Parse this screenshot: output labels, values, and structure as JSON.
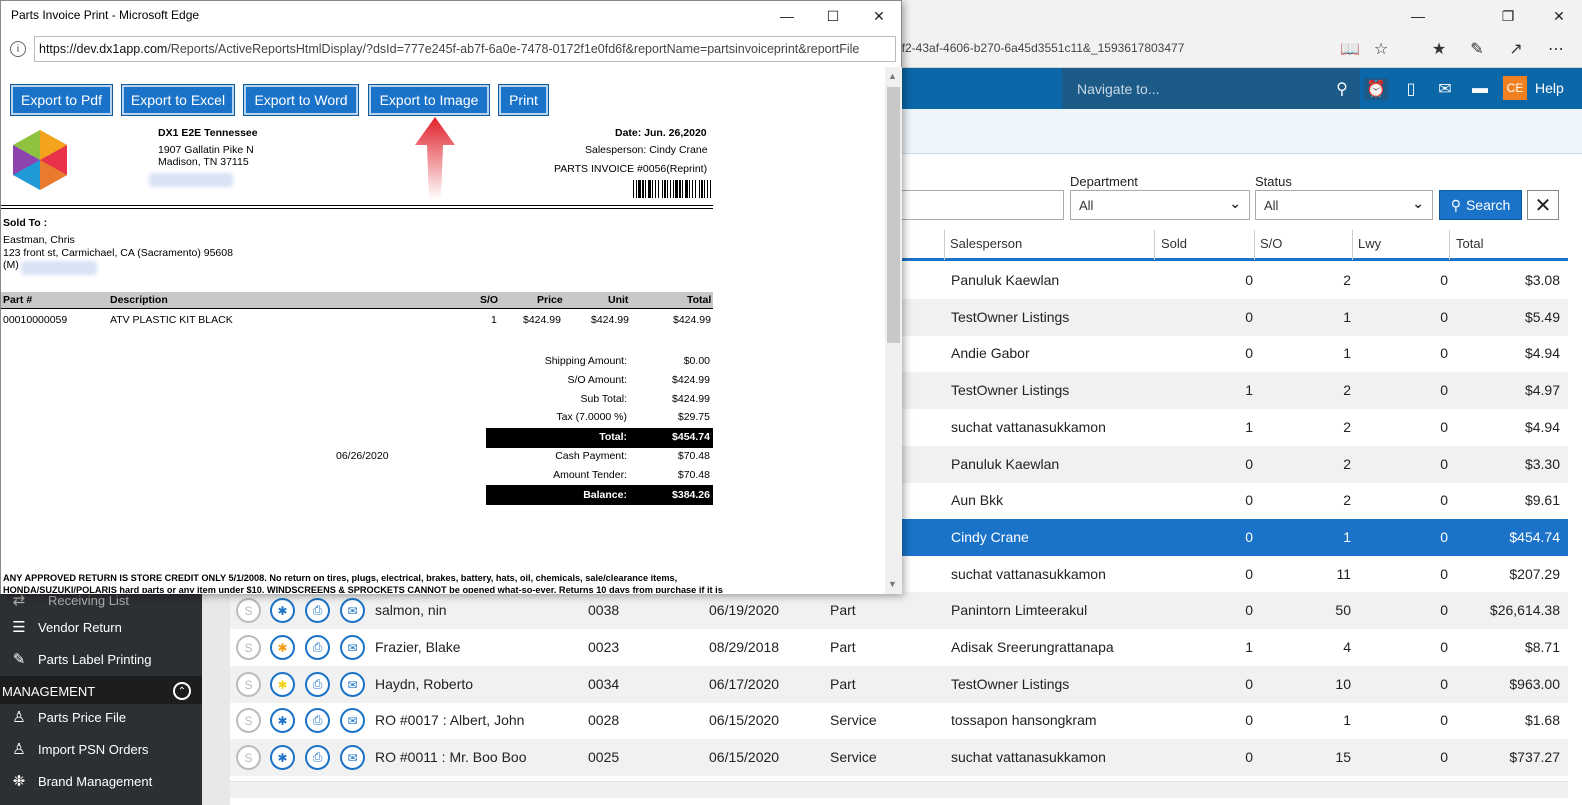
{
  "back_window": {
    "url_tail": "bf2-43af-4606-b270-6a45d3551c11&_1593617803477",
    "nav": {
      "search_placeholder": "Navigate to...",
      "avatar": "CE",
      "help": "Help"
    },
    "filters": {
      "department_label": "Department",
      "department_value": "All",
      "status_label": "Status",
      "status_value": "All",
      "search_button": "Search"
    },
    "table": {
      "headers": [
        "Salesperson",
        "Sold",
        "S/O",
        "Lwy",
        "Total"
      ],
      "rows": [
        {
          "salesperson": "Panuluk Kaewlan",
          "sold": "0",
          "so": "2",
          "lwy": "0",
          "total": "$3.08"
        },
        {
          "salesperson": "TestOwner Listings",
          "sold": "0",
          "so": "1",
          "lwy": "0",
          "total": "$5.49"
        },
        {
          "salesperson": "Andie Gabor",
          "sold": "0",
          "so": "1",
          "lwy": "0",
          "total": "$4.94"
        },
        {
          "salesperson": "TestOwner Listings",
          "sold": "1",
          "so": "2",
          "lwy": "0",
          "total": "$4.97"
        },
        {
          "salesperson": "suchat vattanasukkamon",
          "sold": "1",
          "so": "2",
          "lwy": "0",
          "total": "$4.94"
        },
        {
          "salesperson": "Panuluk Kaewlan",
          "sold": "0",
          "so": "2",
          "lwy": "0",
          "total": "$3.30"
        },
        {
          "salesperson": "Aun Bkk",
          "sold": "0",
          "so": "2",
          "lwy": "0",
          "total": "$9.61"
        },
        {
          "salesperson": "Cindy Crane",
          "sold": "0",
          "so": "1",
          "lwy": "0",
          "total": "$454.74"
        },
        {
          "salesperson": "suchat vattanasukkamon",
          "sold": "0",
          "so": "11",
          "lwy": "0",
          "total": "$207.29"
        },
        {
          "customer": "salmon, nin",
          "no": "0038",
          "date": "06/19/2020",
          "type": "Part",
          "salesperson": "Panintorn Limteerakul",
          "sold": "0",
          "so": "50",
          "lwy": "0",
          "total": "$26,614.38"
        },
        {
          "customer": "Frazier, Blake",
          "no": "0023",
          "date": "08/29/2018",
          "type": "Part",
          "salesperson": "Adisak Sreerungrattanapa",
          "sold": "1",
          "so": "4",
          "lwy": "0",
          "total": "$8.71"
        },
        {
          "customer": "Haydn, Roberto",
          "no": "0034",
          "date": "06/17/2020",
          "type": "Part",
          "salesperson": "TestOwner Listings",
          "sold": "0",
          "so": "10",
          "lwy": "0",
          "total": "$963.00"
        },
        {
          "customer": "RO #0017 : Albert, John",
          "no": "0028",
          "date": "06/15/2020",
          "type": "Service",
          "salesperson": "tossapon hansongkram",
          "sold": "0",
          "so": "1",
          "lwy": "0",
          "total": "$1.68"
        },
        {
          "customer": "RO #0011 : Mr. Boo Boo",
          "no": "0025",
          "date": "06/15/2020",
          "type": "Service",
          "salesperson": "suchat vattanasukkamon",
          "sold": "0",
          "so": "15",
          "lwy": "0",
          "total": "$737.27"
        }
      ]
    },
    "sidebar": {
      "partial": "Receiving List",
      "items": [
        "Vendor Return",
        "Parts Label Printing"
      ],
      "section": "MANAGEMENT",
      "mgmt_items": [
        "Parts Price File",
        "Import PSN Orders",
        "Brand Management"
      ]
    }
  },
  "popup": {
    "title": "Parts Invoice Print - Microsoft Edge",
    "url_host": "https://dev.dx1app.com",
    "url_path": "/Reports/ActiveReportsHtmlDisplay/?dsId=777e245f-ab7f-6a0e-7478-0172f1e0fd6f&reportName=partsinvoiceprint&reportFile",
    "buttons": [
      "Export to Pdf",
      "Export to Excel",
      "Export to Word",
      "Export to Image",
      "Print"
    ],
    "invoice": {
      "dealer_name": "DX1 E2E Tennessee",
      "addr1": "1907 Gallatin Pike N",
      "addr2": "Madison, TN 37115",
      "date": "Date: Jun. 26,2020",
      "salesperson": "Salesperson: Cindy Crane",
      "invoice_no": "PARTS INVOICE #0056(Reprint)",
      "sold_to_label": "Sold To :",
      "customer": "Eastman, Chris",
      "cust_addr": "123 front st, Carmichael, CA (Sacramento) 95608",
      "mobile": "(M)",
      "cols": [
        "Part #",
        "Description",
        "S/O",
        "Price",
        "Unit",
        "Total"
      ],
      "line": {
        "part": "00010000059",
        "desc": "ATV PLASTIC KIT BLACK",
        "so": "1",
        "price": "$424.99",
        "unit": "$424.99",
        "total": "$424.99"
      },
      "totals": [
        {
          "label": "Shipping Amount:",
          "value": "$0.00"
        },
        {
          "label": "S/O Amount:",
          "value": "$424.99"
        },
        {
          "label": "Sub Total:",
          "value": "$424.99"
        },
        {
          "label": "Tax (7.0000 %)",
          "value": "$29.75"
        }
      ],
      "total_label": "Total:",
      "total_value": "$454.74",
      "payment_date": "06/26/2020",
      "payments": [
        {
          "label": "Cash Payment:",
          "value": "$70.48"
        },
        {
          "label": "Amount Tender:",
          "value": "$70.48"
        }
      ],
      "balance_label": "Balance:",
      "balance_value": "$384.26",
      "footer1": "ANY APPROVED RETURN IS STORE CREDIT ONLY 5/1/2008.   No return on tires, plugs, electrical, brakes, battery, hats, oil, chemicals, sale/clearance items,",
      "footer2": "HONDA/SUZUKI/POLARIS hard parts or any item under $10. WINDSCREENS & SPROCKETS CANNOT be opened what-so-ever. Returns 10 days from purchase if it is"
    }
  },
  "colors": {
    "accent": "#1a73c8",
    "nav": "#0b67a7",
    "sidebar": "#2d3033",
    "avatar": "#f08020",
    "arrow": "#e0202a"
  }
}
